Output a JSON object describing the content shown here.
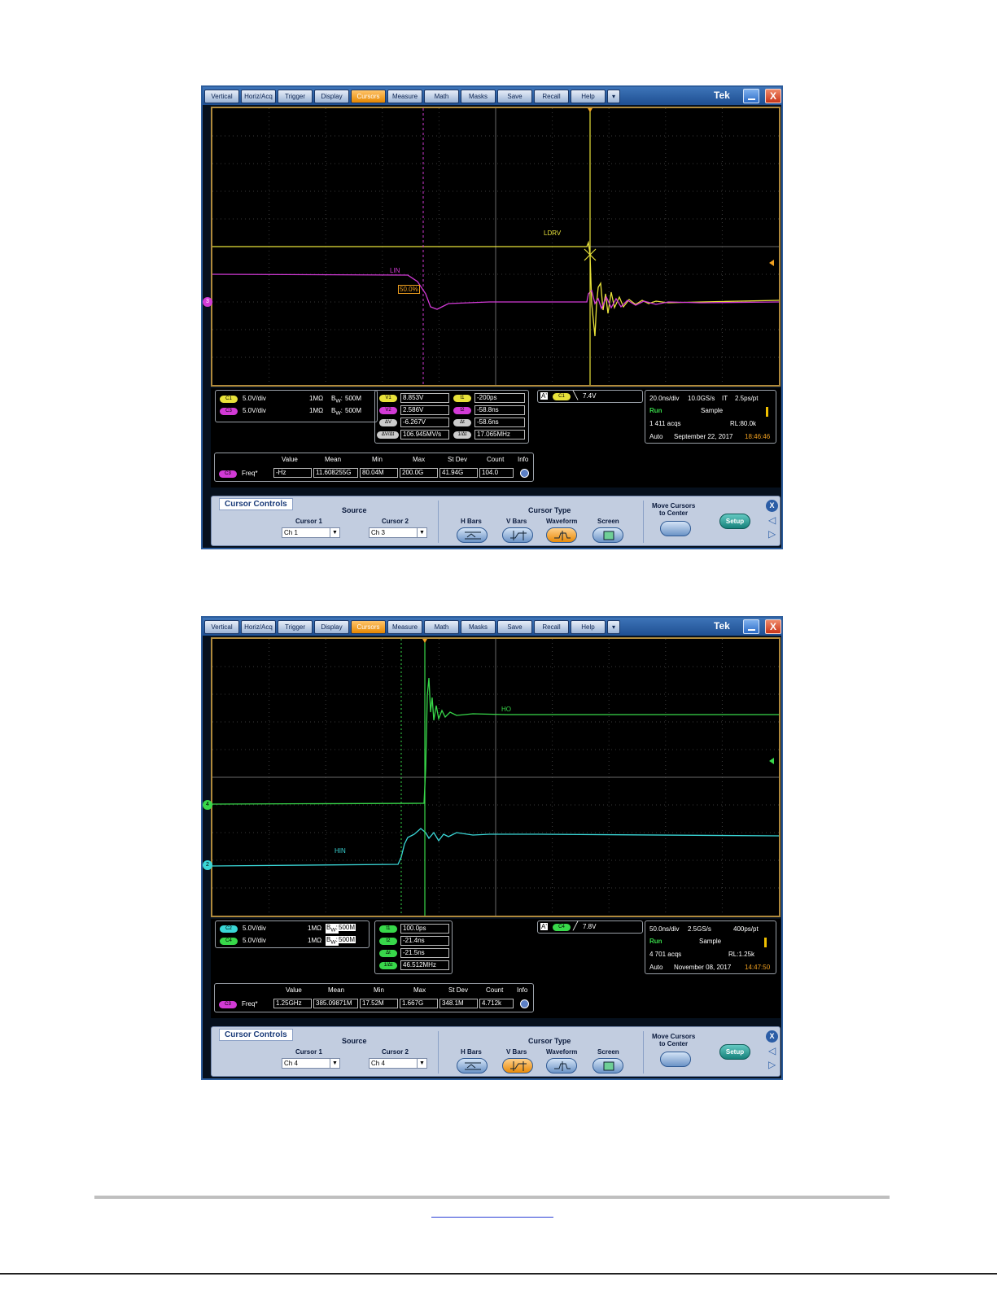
{
  "menu": [
    "Vertical",
    "Horiz/Acq",
    "Trigger",
    "Display",
    "Cursors",
    "Measure",
    "Math",
    "Masks",
    "Save",
    "Recall",
    "Help"
  ],
  "brand": "Tek",
  "close_glyph": "X",
  "scope1": {
    "labels": {
      "ldrv": "LDRV",
      "lin": "LIN",
      "pct": "50.0%",
      "ch_marker": "3"
    },
    "channels": [
      {
        "pill": "C1",
        "color": "#e8e23a",
        "scale": "5.0V/div",
        "imp": "1MΩ",
        "bw": "500M"
      },
      {
        "pill": "C3",
        "color": "#d23ad6",
        "scale": "5.0V/div",
        "imp": "1MΩ",
        "bw": "500M"
      }
    ],
    "cursors": {
      "v1": {
        "pill": "V1",
        "value": "8.853V"
      },
      "v2": {
        "pill": "V2",
        "value": "2.586V"
      },
      "dv": {
        "pill": "ΔV",
        "value": "-6.267V"
      },
      "dvdt": {
        "pill": "ΔV/Δt",
        "value": "106.945MV/s"
      },
      "t1": {
        "pill": "t1",
        "value": "-200ps"
      },
      "t2": {
        "pill": "t2",
        "value": "-58.8ns"
      },
      "dt": {
        "pill": "Δt",
        "value": "-58.6ns"
      },
      "inv": {
        "pill": "1/Δt",
        "value": "17.065MHz"
      }
    },
    "trigger": {
      "a": "A'",
      "pill": "C1",
      "slope": "╲",
      "level": "7.4V"
    },
    "acq": {
      "timebase": "20.0ns/div",
      "rate": "10.0GS/s",
      "mode_it": "IT",
      "res": "2.5ps/pt",
      "run": "Run",
      "sample": "Sample",
      "acqs": "1 411 acqs",
      "rl": "RL:80.0k",
      "auto": "Auto",
      "date": "September 22, 2017",
      "time": "18:46:46"
    },
    "meas": {
      "headers": [
        "Value",
        "Mean",
        "Min",
        "Max",
        "St Dev",
        "Count",
        "Info"
      ],
      "pill": "C3",
      "name": "Freq*",
      "values": [
        "-Hz",
        "11.608255G",
        "80.04M",
        "200.0G",
        "41.94G",
        "104.0"
      ]
    },
    "controls": {
      "title": "Cursor Controls",
      "source": "Source",
      "cursor1": "Cursor 1",
      "cursor2": "Cursor 2",
      "c1val": "Ch 1",
      "c2val": "Ch 3",
      "type": "Cursor Type",
      "hbars": "H Bars",
      "vbars": "V Bars",
      "waveform": "Waveform",
      "screen": "Screen",
      "move": "Move Cursors",
      "move2": "to Center",
      "setup": "Setup",
      "active": "waveform"
    }
  },
  "scope2": {
    "labels": {
      "ho": "HO",
      "hin": "HIN",
      "ch4": "4",
      "ch2": "2"
    },
    "channels": [
      {
        "pill": "C2",
        "color": "#3ad6d6",
        "scale": "5.0V/div",
        "imp": "1MΩ",
        "bw": "500M"
      },
      {
        "pill": "C4",
        "color": "#38d84a",
        "scale": "5.0V/div",
        "imp": "1MΩ",
        "bw": "500M"
      }
    ],
    "cursors": {
      "t1": {
        "pill": "t1",
        "value": "100.0ps"
      },
      "t2": {
        "pill": "t2",
        "value": "-21.4ns"
      },
      "dt": {
        "pill": "Δt",
        "value": "-21.5ns"
      },
      "inv": {
        "pill": "1/Δt",
        "value": "46.512MHz"
      }
    },
    "trigger": {
      "a": "A'",
      "pill": "C4",
      "slope": "╱",
      "level": "7.8V"
    },
    "acq": {
      "timebase": "50.0ns/div",
      "rate": "2.5GS/s",
      "res": "400ps/pt",
      "run": "Run",
      "sample": "Sample",
      "acqs": "4 701 acqs",
      "rl": "RL:1.25k",
      "auto": "Auto",
      "date": "November 08, 2017",
      "time": "14:47:50"
    },
    "meas": {
      "headers": [
        "Value",
        "Mean",
        "Min",
        "Max",
        "St Dev",
        "Count",
        "Info"
      ],
      "pill": "C3",
      "name": "Freq*",
      "values": [
        "1.25GHz",
        "385.09871M",
        "17.52M",
        "1.667G",
        "348.1M",
        "4.712k"
      ]
    },
    "controls": {
      "title": "Cursor Controls",
      "source": "Source",
      "cursor1": "Cursor 1",
      "cursor2": "Cursor 2",
      "c1val": "Ch 4",
      "c2val": "Ch 4",
      "type": "Cursor Type",
      "hbars": "H Bars",
      "vbars": "V Bars",
      "waveform": "Waveform",
      "screen": "Screen",
      "move": "Move Cursors",
      "move2": "to Center",
      "setup": "Setup",
      "active": "vbars"
    }
  },
  "colors": {
    "c1": "#e8e23a",
    "c2": "#3ad6d6",
    "c3": "#d23ad6",
    "c4": "#38d84a",
    "accent": "#f0a020",
    "frame": "#2d5d9c"
  }
}
